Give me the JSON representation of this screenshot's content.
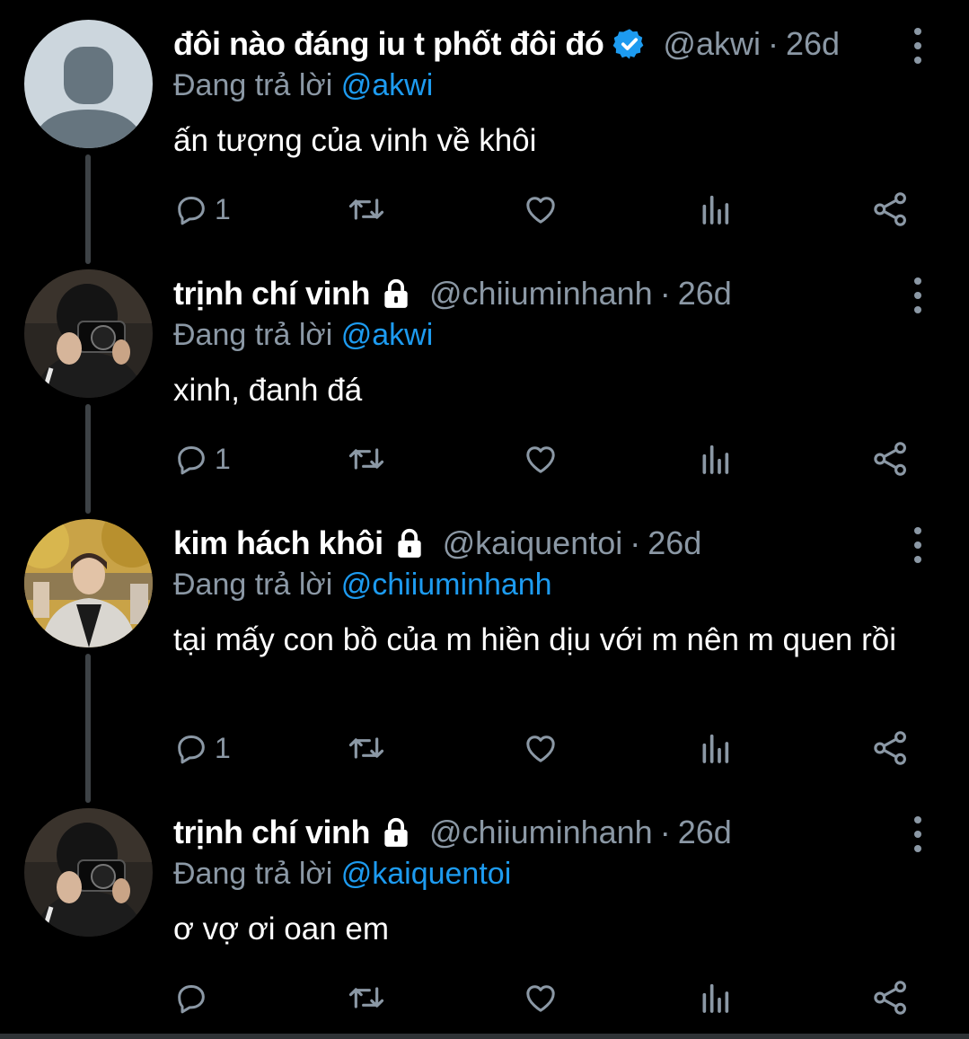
{
  "colors": {
    "background": "#000000",
    "text": "#ffffff",
    "muted": "#8b98a5",
    "accent": "#1d9bf0",
    "thread_line": "#3d4246"
  },
  "tweets": [
    {
      "display_name": "đôi nào đáng iu t phốt đôi đó",
      "badge": "verified-icon",
      "handle": "@akwi",
      "separator": "·",
      "time": "26d",
      "reply_prefix": "Đang trả lời",
      "reply_to": "@akwi",
      "text": "ấn tượng của vinh về khôi",
      "reply_count": "1",
      "avatar": "default-avatar"
    },
    {
      "display_name": "trịnh chí vinh",
      "badge": "lock-icon",
      "handle": "@chiiuminhanh",
      "separator": "·",
      "time": "26d",
      "reply_prefix": "Đang trả lời",
      "reply_to": "@akwi",
      "text": "xinh, đanh đá",
      "reply_count": "1",
      "avatar": "photo-camera-person"
    },
    {
      "display_name": "kim hách khôi",
      "badge": "lock-icon",
      "handle": "@kaiquentoi",
      "separator": "·",
      "time": "26d",
      "reply_prefix": "Đang trả lời",
      "reply_to": "@chiiuminhanh",
      "text": "tại mấy con bồ của m hiền dịu với m nên m quen rồi",
      "reply_count": "1",
      "avatar": "photo-person-autumn"
    },
    {
      "display_name": "trịnh chí vinh",
      "badge": "lock-icon",
      "handle": "@chiiuminhanh",
      "separator": "·",
      "time": "26d",
      "reply_prefix": "Đang trả lời",
      "reply_to": "@kaiquentoi",
      "text": "ơ vợ ơi oan em",
      "reply_count": "",
      "avatar": "photo-camera-person"
    }
  ]
}
